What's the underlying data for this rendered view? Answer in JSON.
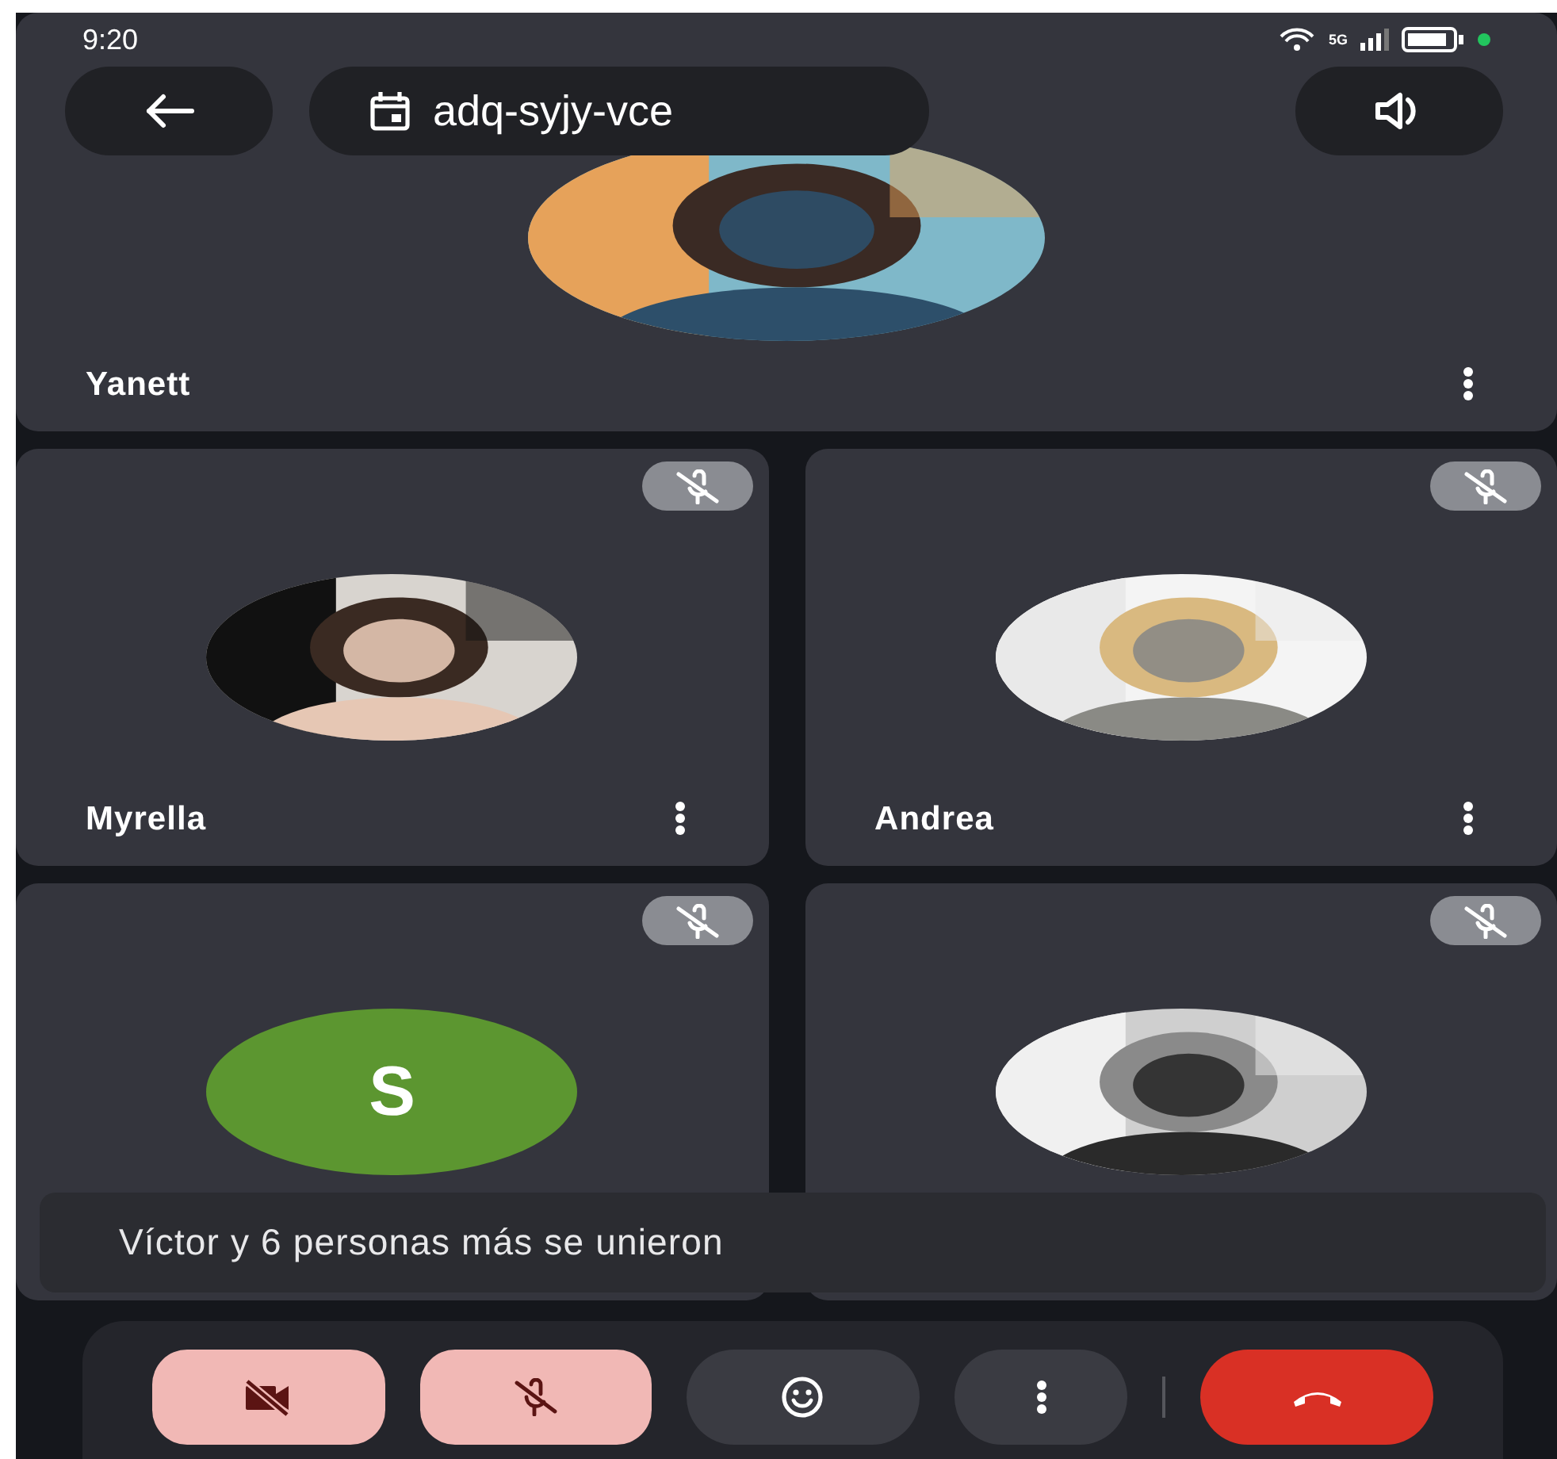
{
  "status_bar": {
    "time": "9:20",
    "network": "5G"
  },
  "top_bar": {
    "meeting_code": "adq-syjy-vce"
  },
  "participants": [
    {
      "name": "Yanett",
      "muted": false
    },
    {
      "name": "Myrella",
      "muted": true
    },
    {
      "name": "Andrea",
      "muted": true
    },
    {
      "muted": true,
      "avatar": {
        "kind": "initial",
        "letter": "S",
        "color": "#5c9630"
      }
    },
    {
      "muted": true
    }
  ],
  "toast": {
    "text": "Víctor y 6 personas más se unieron"
  },
  "controls": [
    {
      "kind": "camera",
      "on": false
    },
    {
      "kind": "microphone",
      "on": false
    },
    {
      "kind": "reactions"
    },
    {
      "kind": "more"
    },
    {
      "kind": "hang-up"
    }
  ]
}
